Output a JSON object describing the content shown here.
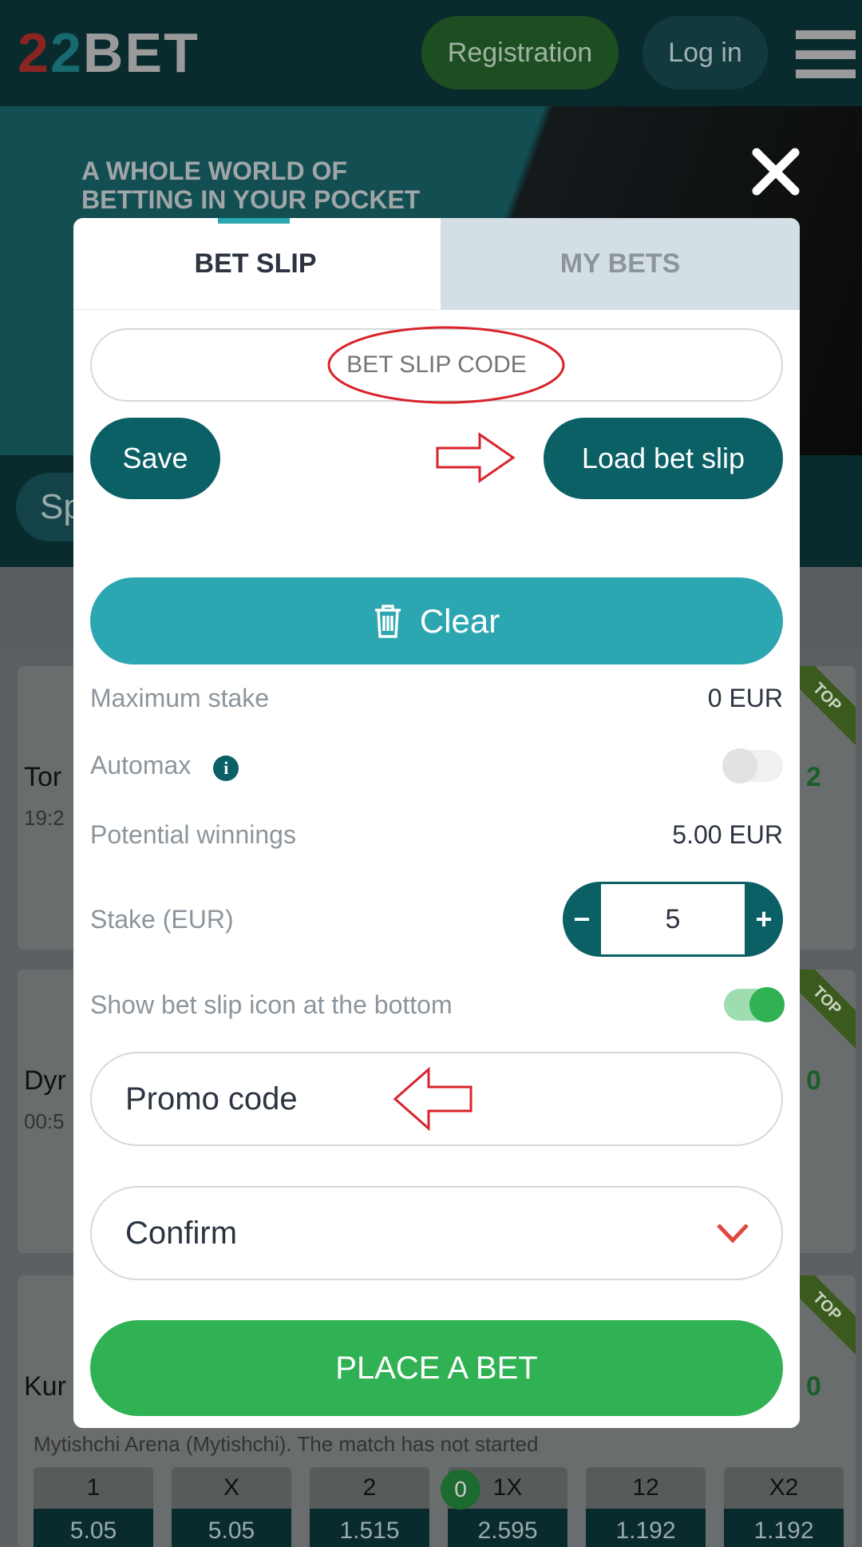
{
  "header": {
    "logo": "22BET",
    "register_label": "Registration",
    "login_label": "Log in"
  },
  "banner": {
    "line1": "A WHOLE WORLD OF",
    "line2": "BETTING IN YOUR POCKET"
  },
  "search": {
    "partial": "Sp"
  },
  "background_events": [
    {
      "name_partial": "Tor",
      "time_partial": "19:2",
      "score_partial": "2"
    },
    {
      "name_partial": "Dyr",
      "time_partial": "00:5",
      "score_partial": "0"
    },
    {
      "name_partial": "Kur",
      "subtitle": "Mytishchi Arena (Mytishchi). The match has not started",
      "score_partial": "0",
      "odds": [
        {
          "label": "1",
          "value": "5.05"
        },
        {
          "label": "X",
          "value": "5.05"
        },
        {
          "label": "2",
          "value": "1.515"
        },
        {
          "label": "1X",
          "value": "2.595"
        },
        {
          "label": "12",
          "value": "1.192"
        },
        {
          "label": "X2",
          "value": "1.192"
        }
      ]
    }
  ],
  "badge_top": "TOP",
  "betslip_count": "0",
  "modal": {
    "tabs": [
      {
        "label": "BET SLIP",
        "active": true
      },
      {
        "label": "MY BETS",
        "active": false
      }
    ],
    "code_placeholder": "BET SLIP CODE",
    "save_label": "Save",
    "load_label": "Load bet slip",
    "clear_label": "Clear",
    "max_stake_label": "Maximum stake",
    "max_stake_value": "0 EUR",
    "automax_label": "Automax",
    "automax_on": false,
    "potential_label": "Potential winnings",
    "potential_value": "5.00 EUR",
    "stake_label": "Stake (EUR)",
    "stake_value": "5",
    "show_icon_label": "Show bet slip icon at the bottom",
    "show_icon_on": true,
    "promo_label": "Promo code",
    "confirm_label": "Confirm",
    "place_label": "PLACE A BET"
  },
  "colors": {
    "accent": "#2ca6b0",
    "dark_teal": "#0b6066",
    "green": "#2fb154",
    "annotation_red": "#d9232b"
  }
}
